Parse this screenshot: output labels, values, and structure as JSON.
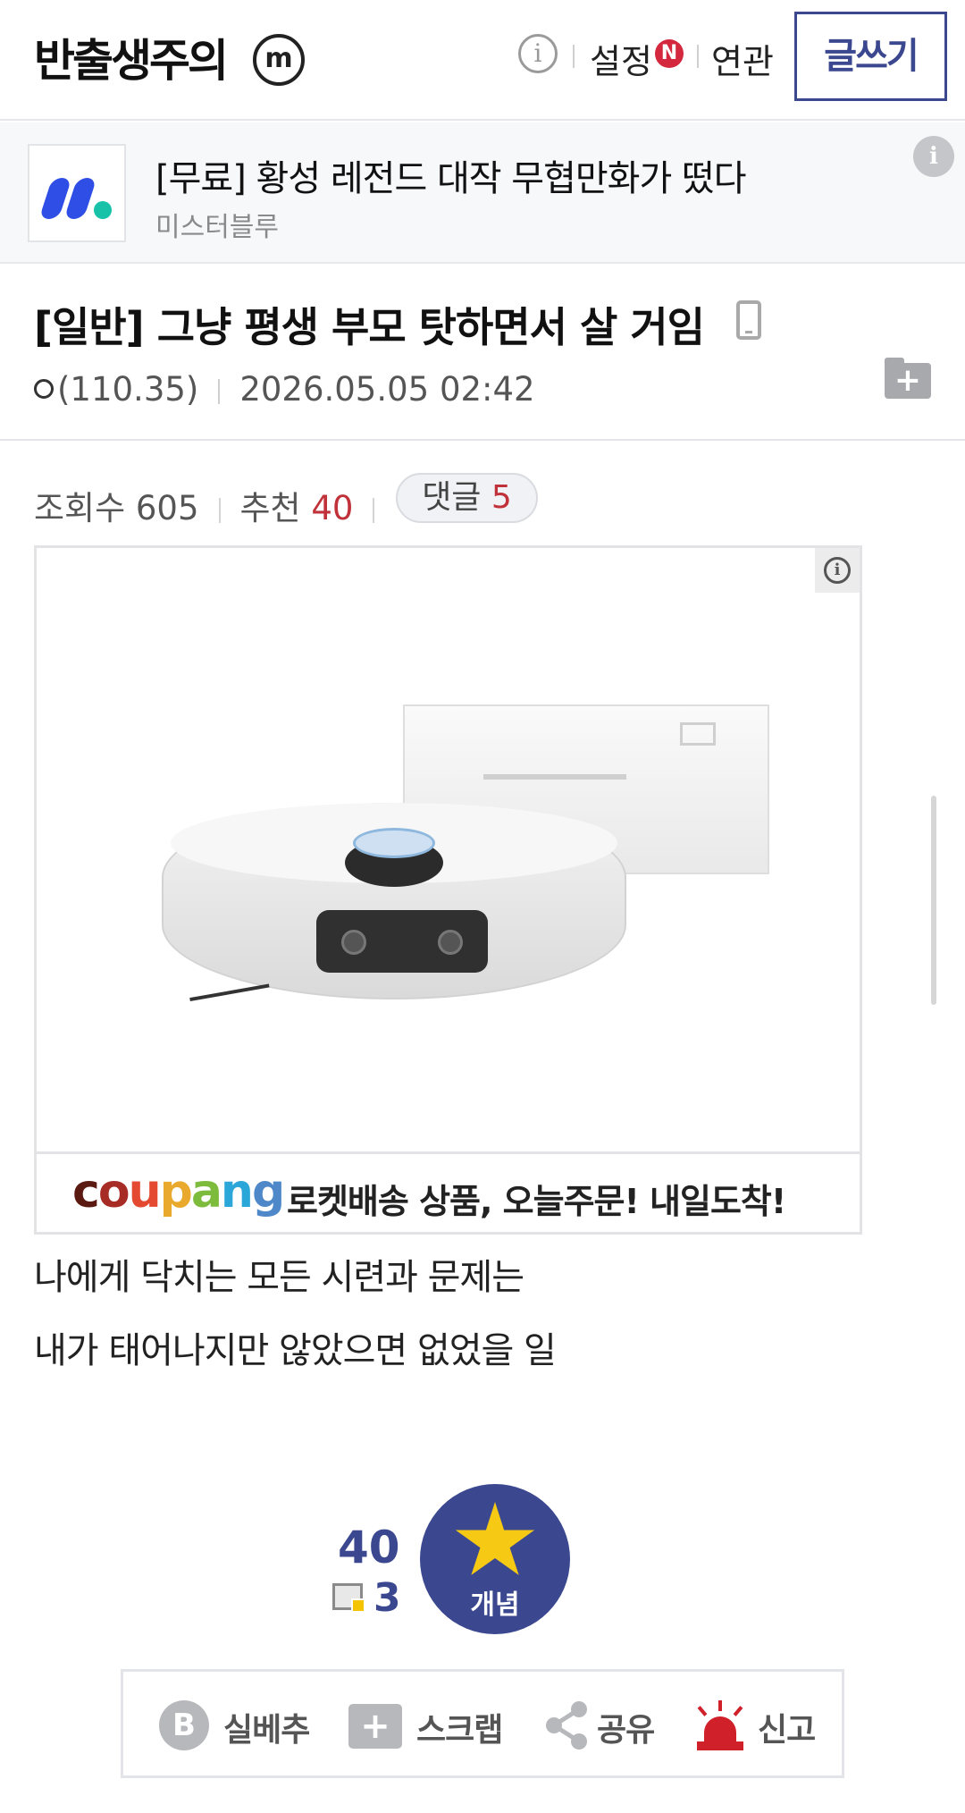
{
  "header": {
    "brand": "반출생주의",
    "brand_badge": "m",
    "settings_label": "설정",
    "new_badge": "N",
    "related_label": "연관",
    "write_label": "글쓰기"
  },
  "top_ad": {
    "title": "[무료] 황성 레전드 대작 무협만화가 떴다",
    "advertiser": "미스터블루"
  },
  "post": {
    "title": "[일반] 그냥 평생 부모 탓하면서 살 거임",
    "author_ip": "(110.35)",
    "datetime": "2026.05.05 02:42",
    "views_label": "조회수",
    "views": "605",
    "recommend_label": "추천",
    "recommend": "40",
    "comments_label": "댓글",
    "comments": "5",
    "body": [
      "나에게 닥치는 모든 시련과 문제는",
      "내가 태어나지만 않았으면 없었을 일"
    ]
  },
  "inline_ad": {
    "brand_parts": [
      "c",
      "o",
      "u",
      "p",
      "a",
      "n",
      "g"
    ],
    "tagline": "로켓배송 상품, 오늘주문! 내일도착!"
  },
  "recommend_box": {
    "count": "40",
    "fix_count": "3",
    "button_label": "개념"
  },
  "actions": {
    "silbe_label": "실베추",
    "scrap_label": "스크랩",
    "share_label": "공유",
    "report_label": "신고"
  },
  "colors": {
    "accent": "#3b4890",
    "highlight_red": "#c0313a",
    "star": "#f6c915"
  }
}
